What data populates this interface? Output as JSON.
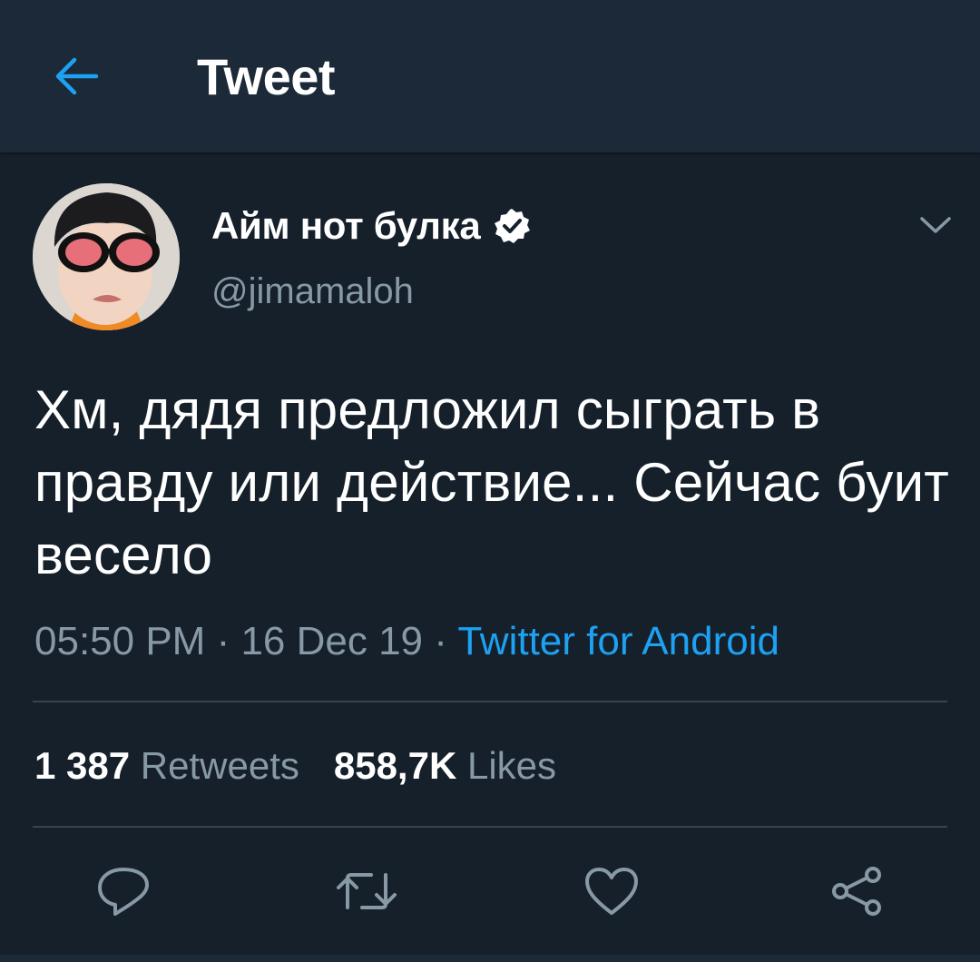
{
  "header": {
    "back_icon": "arrow-left-icon",
    "title": "Tweet"
  },
  "tweet": {
    "author": {
      "display_name": "Айм нот булка",
      "handle": "@jimamaloh",
      "verified": true
    },
    "text": "Хм, дядя предложил сыграть в правду или действие... Сейчас буит весело",
    "time": "05:50 PM",
    "date": "16 Dec 19",
    "separator": " · ",
    "source": "Twitter for Android",
    "stats": {
      "retweets_count": "1 387",
      "retweets_label": "Retweets",
      "likes_count": "858,7K",
      "likes_label": "Likes"
    }
  },
  "actions": [
    "reply-icon",
    "retweet-icon",
    "like-icon",
    "share-icon"
  ],
  "colors": {
    "background": "#15202b",
    "header_bg": "#1c2938",
    "accent": "#1da1f2",
    "muted_text": "#8899a6",
    "divider": "#38444d"
  }
}
